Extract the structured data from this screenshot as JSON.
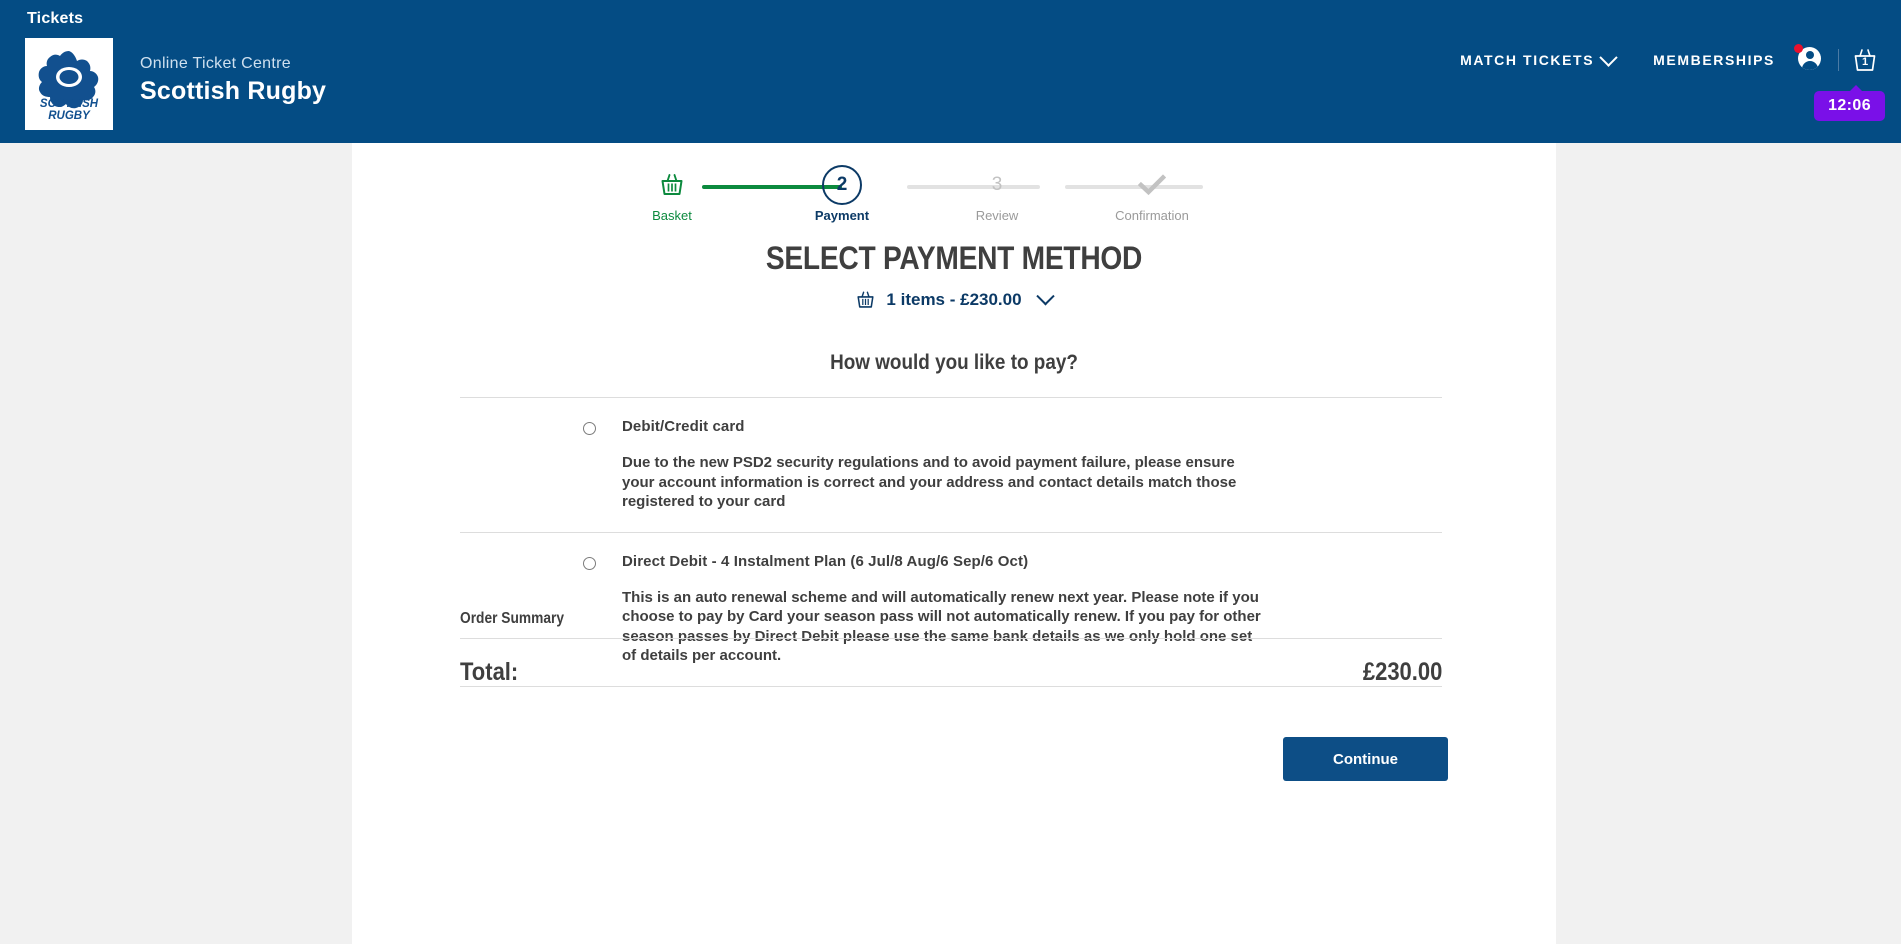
{
  "header": {
    "tickets_label": "Tickets",
    "brand_small": "Online Ticket Centre",
    "brand_big": "Scottish Rugby",
    "logo_line1": "SCOTTISH",
    "logo_line2": "RUGBY",
    "nav": [
      {
        "label": "MATCH TICKETS",
        "has_dropdown": true
      },
      {
        "label": "MEMBERSHIPS",
        "has_dropdown": false
      }
    ],
    "basket_count": "1",
    "timer": "12:06",
    "colors": {
      "header_bg": "#044c84",
      "timer_bg": "#7a10e8",
      "notification_dot": "#e8112d"
    }
  },
  "stepper": {
    "steps": [
      {
        "label": "Basket",
        "mark": "basket-icon",
        "state": "completed"
      },
      {
        "label": "Payment",
        "mark": "2",
        "state": "active"
      },
      {
        "label": "Review",
        "mark": "3",
        "state": "todo"
      },
      {
        "label": "Confirmation",
        "mark": "check-icon",
        "state": "todo"
      }
    ],
    "colors": {
      "done": "#0c8a3e",
      "active": "#0c3a66",
      "todo": "#c2c2c2"
    }
  },
  "main": {
    "page_title": "SELECT PAYMENT METHOD",
    "cart_summary": "1 items - £230.00",
    "pay_question": "How would you like to pay?",
    "payment_options": [
      {
        "title": "Debit/Credit card",
        "description": "Due to the new PSD2 security regulations and to avoid payment failure, please ensure your account information is correct and your address and contact details match those registered to your card",
        "selected": false
      },
      {
        "title": "Direct Debit - 4 Instalment Plan (6 Jul/8 Aug/6 Sep/6 Oct)",
        "description": "This is an auto renewal scheme and will automatically renew next year. Please note if you choose to pay by Card your season pass will not automatically renew. If you pay for other season passes by Direct Debit please use the same bank details as we only hold one set of details per account.",
        "selected": false
      }
    ],
    "order_summary": {
      "heading": "Order Summary",
      "total_label": "Total:",
      "total_value": "£230.00"
    },
    "continue_button": "Continue"
  }
}
